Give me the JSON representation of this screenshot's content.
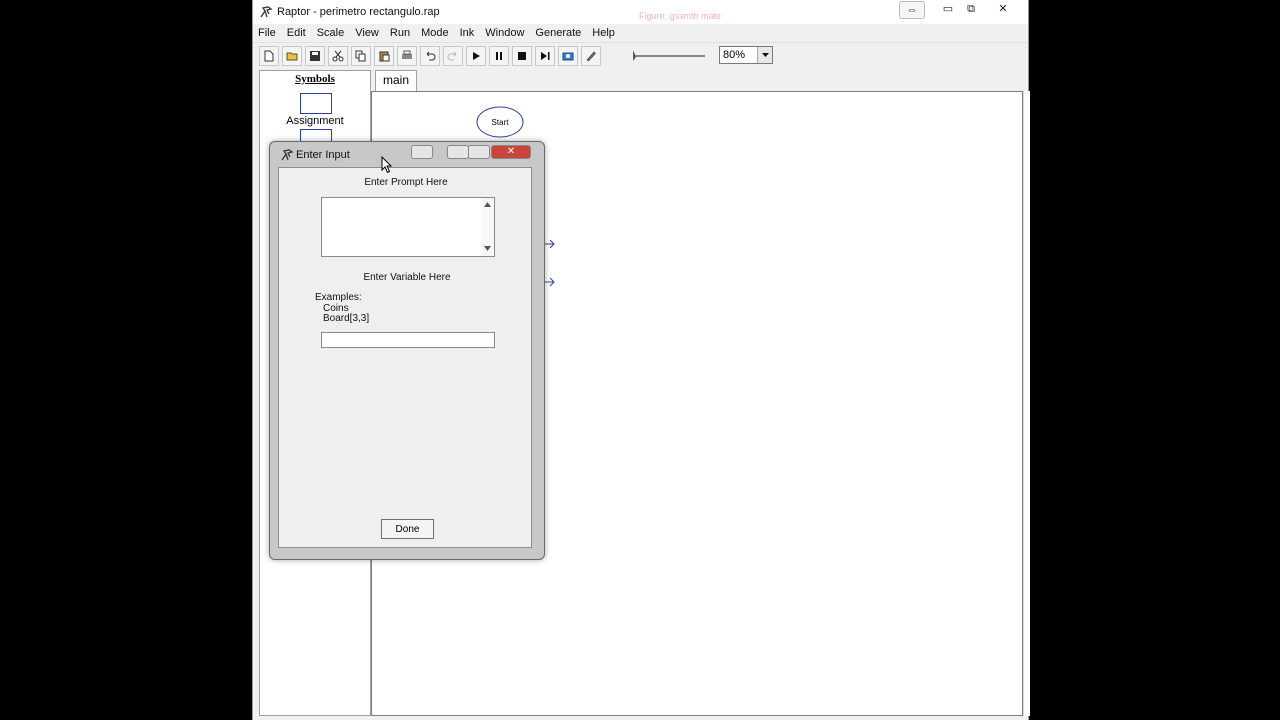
{
  "window": {
    "title": "Raptor - perimetro rectangulo.rap",
    "controls": {
      "restore": "⇔",
      "minimize": "▭",
      "maximize": "⧉",
      "close": "✕"
    },
    "faint_text": "Figure: gssmth mate"
  },
  "menu": [
    "File",
    "Edit",
    "Scale",
    "View",
    "Run",
    "Mode",
    "Ink",
    "Window",
    "Generate",
    "Help"
  ],
  "toolbar": {
    "buttons": [
      "new-file-icon",
      "open-folder-icon",
      "save-icon",
      "cut-icon",
      "copy-icon",
      "paste-icon",
      "print-icon",
      "undo-icon",
      "redo-icon",
      "play-icon",
      "pause-icon",
      "stop-icon",
      "step-icon",
      "test-icon",
      "pen-icon"
    ],
    "zoom_value": "80%"
  },
  "symbols": {
    "title": "Symbols",
    "assignment_label": "Assignment"
  },
  "tabs": [
    {
      "label": "main"
    }
  ],
  "flowchart": {
    "start_label": "Start"
  },
  "dialog": {
    "title": "Enter Input",
    "prompt_label": "Enter Prompt Here",
    "prompt_value": "",
    "variable_label": "Enter Variable Here",
    "examples_heading": "Examples:",
    "example_1": "Coins",
    "example_2": "Board[3,3]",
    "variable_value": "",
    "done_label": "Done"
  }
}
